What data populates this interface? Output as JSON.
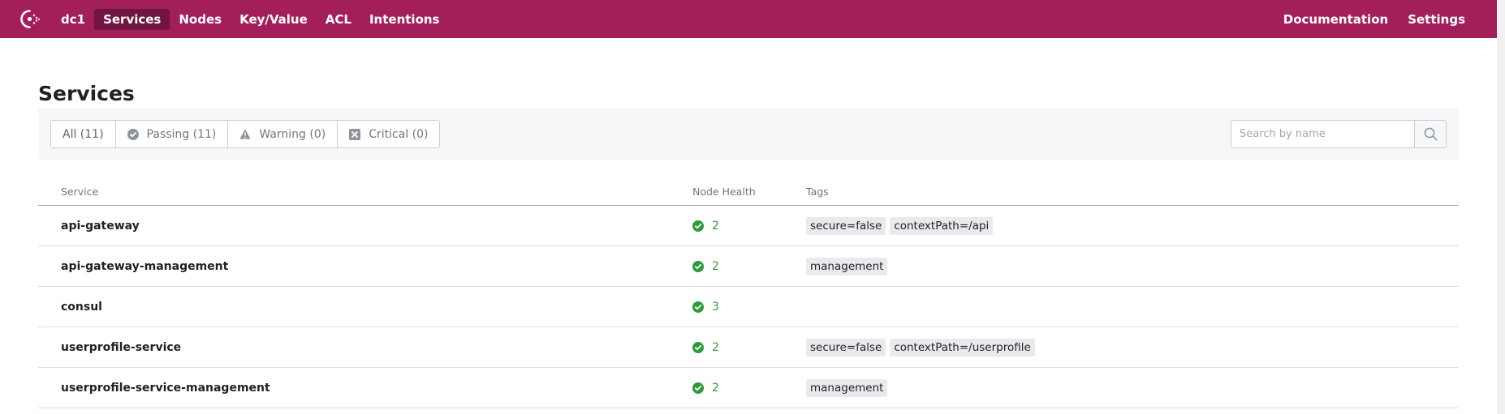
{
  "nav": {
    "datacenter": "dc1",
    "items": [
      {
        "label": "Services",
        "active": true
      },
      {
        "label": "Nodes",
        "active": false
      },
      {
        "label": "Key/Value",
        "active": false
      },
      {
        "label": "ACL",
        "active": false
      },
      {
        "label": "Intentions",
        "active": false
      }
    ],
    "right_items": [
      {
        "label": "Documentation"
      },
      {
        "label": "Settings"
      }
    ]
  },
  "page": {
    "title": "Services"
  },
  "filters": [
    {
      "label": "All (11)",
      "icon": "none",
      "selected": true
    },
    {
      "label": "Passing (11)",
      "icon": "check-circle-icon",
      "selected": false
    },
    {
      "label": "Warning (0)",
      "icon": "warning-triangle-icon",
      "selected": false
    },
    {
      "label": "Critical (0)",
      "icon": "critical-x-icon",
      "selected": false
    }
  ],
  "search": {
    "placeholder": "Search by name",
    "value": ""
  },
  "table": {
    "columns": [
      "Service",
      "Node Health",
      "Tags"
    ],
    "rows": [
      {
        "service": "api-gateway",
        "health": "2",
        "tags": [
          "secure=false",
          "contextPath=/api"
        ]
      },
      {
        "service": "api-gateway-management",
        "health": "2",
        "tags": [
          "management"
        ]
      },
      {
        "service": "consul",
        "health": "3",
        "tags": []
      },
      {
        "service": "userprofile-service",
        "health": "2",
        "tags": [
          "secure=false",
          "contextPath=/userprofile"
        ]
      },
      {
        "service": "userprofile-service-management",
        "health": "2",
        "tags": [
          "management"
        ]
      }
    ]
  },
  "colors": {
    "brand": "#a21f5a",
    "nav_active": "#6f1540",
    "passing": "#2e9b3a"
  }
}
